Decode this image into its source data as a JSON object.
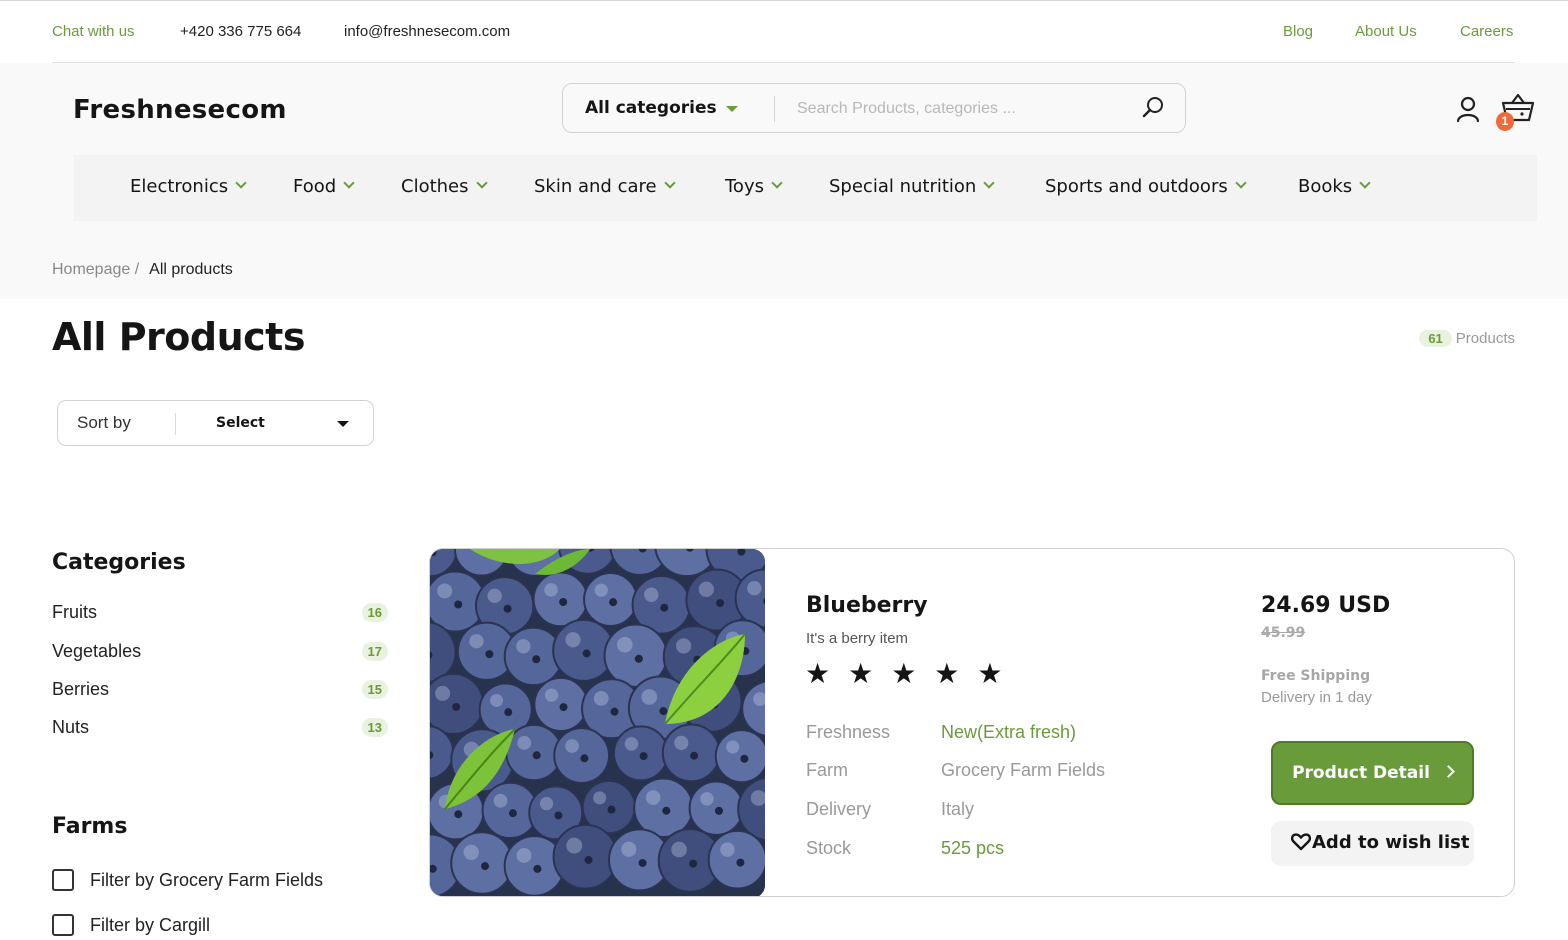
{
  "topbar": {
    "chat": "Chat with us",
    "phone": "+420 336 775 664",
    "email": "info@freshnesecom.com",
    "links": [
      "Blog",
      "About Us",
      "Careers"
    ]
  },
  "header": {
    "logo": "Freshnesecom",
    "search_category": "All categories",
    "search_placeholder": "Search Products, categories ...",
    "cart_count": "1"
  },
  "nav": {
    "items": [
      "Electronics",
      "Food",
      "Clothes",
      "Skin and care",
      "Toys",
      "Special nutrition",
      "Sports and outdoors",
      "Books"
    ]
  },
  "breadcrumb": {
    "home": "Homepage /",
    "current": "All products"
  },
  "page": {
    "title": "All Products",
    "count": "61",
    "count_label": "Products",
    "sort_label": "Sort by",
    "sort_value": "Select"
  },
  "sidebar": {
    "categories_title": "Categories",
    "categories": [
      {
        "name": "Fruits",
        "count": "16"
      },
      {
        "name": "Vegetables",
        "count": "17"
      },
      {
        "name": "Berries",
        "count": "15"
      },
      {
        "name": "Nuts",
        "count": "13"
      }
    ],
    "farms_title": "Farms",
    "farms": [
      "Filter by Grocery Farm Fields",
      "Filter by Cargill"
    ]
  },
  "product": {
    "name": "Blueberry",
    "description": "It's a berry item",
    "rating": 5,
    "stars": "★★★★★",
    "specs": [
      {
        "key": "Freshness",
        "value": "New(Extra fresh)"
      },
      {
        "key": "Farm",
        "value": "Grocery Farm Fields"
      },
      {
        "key": "Delivery",
        "value": "Italy"
      },
      {
        "key": "Stock",
        "value": "525 pcs"
      }
    ],
    "price": "24.69 USD",
    "old_price": "45.99",
    "shipping": "Free Shipping",
    "delivery_time": "Delivery in 1 day",
    "detail_button": "Product Detail",
    "wish_button": "Add to wish list"
  },
  "colors": {
    "accent": "#6a9b3b",
    "badge": "#ef6a3a",
    "badge_bg": "#e9f2df"
  }
}
